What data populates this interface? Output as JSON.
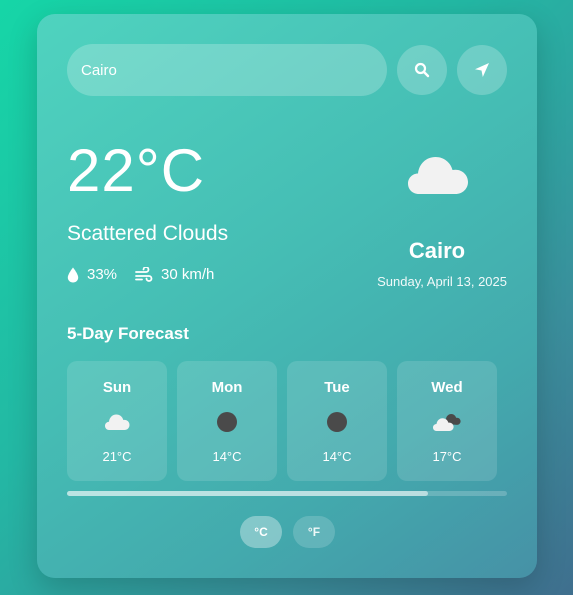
{
  "search": {
    "value": "Cairo",
    "placeholder": "Cairo",
    "search_icon": "search-icon",
    "locate_icon": "location-arrow-icon"
  },
  "current": {
    "temperature": "22°C",
    "condition": "Scattered Clouds",
    "humidity": "33%",
    "wind": "30 km/h",
    "humidity_icon": "droplet-icon",
    "wind_icon": "wind-icon",
    "weather_icon": "cloud-icon",
    "city": "Cairo",
    "date": "Sunday, April 13, 2025"
  },
  "forecast": {
    "title": "5-Day Forecast",
    "days": [
      {
        "day": "Sun",
        "temp": "21°C",
        "icon": "cloud-icon"
      },
      {
        "day": "Mon",
        "temp": "14°C",
        "icon": "dark-circle-icon"
      },
      {
        "day": "Tue",
        "temp": "14°C",
        "icon": "dark-circle-icon"
      },
      {
        "day": "Wed",
        "temp": "17°C",
        "icon": "broken-clouds-icon"
      }
    ],
    "scroll_fraction": 0.82
  },
  "units": {
    "celsius_label": "°C",
    "fahrenheit_label": "°F",
    "selected": "°C"
  },
  "colors": {
    "accent_white": "#ffffff",
    "dark_icon": "#4a4a4a"
  }
}
